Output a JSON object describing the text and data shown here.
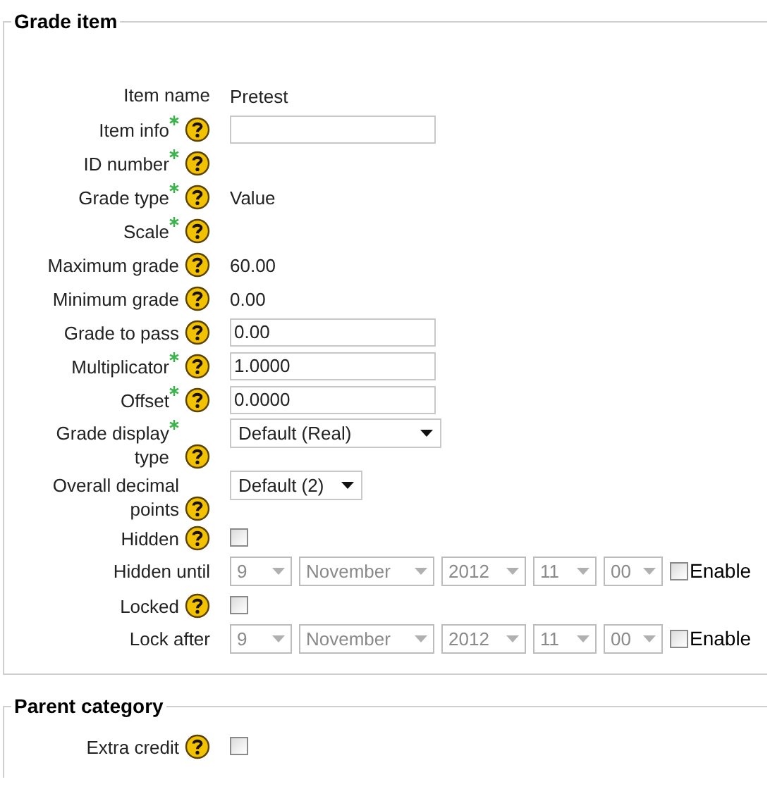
{
  "sections": [
    {
      "legend": "Grade item",
      "fields": [
        {
          "kind": "static",
          "label": "Item name",
          "required": false,
          "help": false,
          "value": "Pretest"
        },
        {
          "kind": "text",
          "label": "Item info",
          "required": true,
          "help": true
        },
        {
          "kind": "static",
          "label": "ID number",
          "required": true,
          "help": true
        },
        {
          "kind": "static",
          "label": "Grade type",
          "required": true,
          "help": true,
          "value": "Value"
        },
        {
          "kind": "static",
          "label": "Scale",
          "required": true,
          "help": true
        },
        {
          "kind": "static",
          "label": "Maximum grade",
          "required": false,
          "help": true,
          "value": "60.00"
        },
        {
          "kind": "static",
          "label": "Minimum grade",
          "required": false,
          "help": true,
          "value": "0.00"
        },
        {
          "kind": "text",
          "label": "Grade to pass",
          "required": false,
          "help": true,
          "value": "0.00"
        },
        {
          "kind": "text",
          "label": "Multiplicator",
          "required": true,
          "help": true,
          "value": "1.0000"
        },
        {
          "kind": "text",
          "label": "Offset",
          "required": true,
          "help": true,
          "value": "0.0000"
        },
        {
          "kind": "select",
          "label": "Grade display type",
          "required": true,
          "help": true,
          "value": "Default (Real)",
          "wide": true
        },
        {
          "kind": "select",
          "label": "Overall decimal points",
          "required": false,
          "help": true,
          "value": "Default (2)",
          "wide": false
        },
        {
          "kind": "checkbox",
          "label": "Hidden",
          "required": false,
          "help": true,
          "checked": false
        },
        {
          "kind": "date",
          "label": "Hidden until",
          "required": false,
          "help": false,
          "disabled": true,
          "parts": [
            "9",
            "November",
            "2012",
            "11",
            "00"
          ],
          "enable": {
            "label": "Enable",
            "checked": false
          }
        },
        {
          "kind": "checkbox",
          "label": "Locked",
          "required": false,
          "help": true,
          "checked": false
        },
        {
          "kind": "date",
          "label": "Lock after",
          "required": false,
          "help": false,
          "disabled": true,
          "parts": [
            "9",
            "November",
            "2012",
            "11",
            "00"
          ],
          "enable": {
            "label": "Enable",
            "checked": false
          }
        }
      ]
    },
    {
      "legend": "Parent category",
      "fields": [
        {
          "kind": "checkbox",
          "label": "Extra credit",
          "required": false,
          "help": true,
          "checked": false
        }
      ]
    }
  ]
}
